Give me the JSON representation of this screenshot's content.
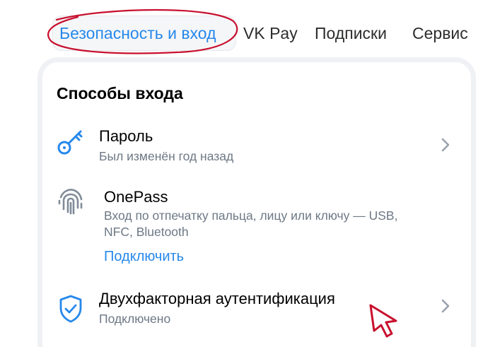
{
  "tabs": [
    {
      "label": "Безопасность и вход",
      "active": true
    },
    {
      "label": "VK Pay",
      "active": false
    },
    {
      "label": "Подписки",
      "active": false
    },
    {
      "label": "Сервис",
      "active": false
    }
  ],
  "section": {
    "title": "Способы входа"
  },
  "rows": {
    "password": {
      "title": "Пароль",
      "subtitle": "Был изменён год назад",
      "icon": "key-icon"
    },
    "onepass": {
      "title": "OnePass",
      "subtitle_line1": "Вход по отпечатку пальца, лицу или ключу — USB,",
      "subtitle_line2": "NFC, Bluetooth",
      "action": "Подключить",
      "icon": "fingerprint-icon"
    },
    "twofa": {
      "title": "Двухфакторная аутентификация",
      "subtitle": "Подключено",
      "icon": "shield-check-icon"
    }
  },
  "colors": {
    "accent": "#2688eb",
    "text_primary": "#000000",
    "text_secondary": "#6d7885",
    "annotation": "#c8102e"
  }
}
